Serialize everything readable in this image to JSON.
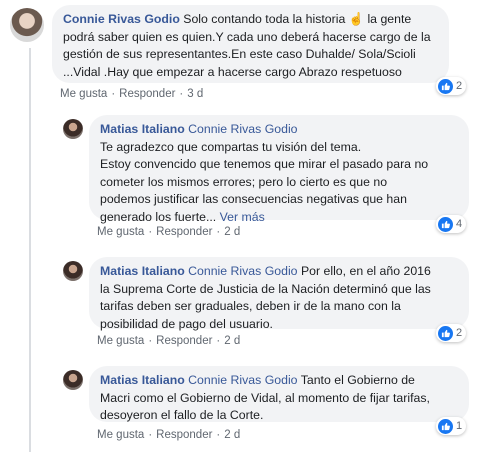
{
  "comments": [
    {
      "author": "Connie Rivas Godio",
      "text_line1": "Solo contando toda la historia",
      "emoji": "☝",
      "text_line1b": "la gente",
      "line2": "podrá saber quien es quien.Y cada uno deberá hacerse cargo de la",
      "line3": "gestión de sus representantes.En este caso Duhalde/ Sola/Scioli",
      "line4": "...Vidal .Hay que empezar a hacerse cargo Abrazo respetuoso",
      "like": "Me gusta",
      "reply": "Responder",
      "sep": "·",
      "time": "3 d",
      "reactions": "2"
    },
    {
      "author": "Matias Italiano",
      "mention": "Connie Rivas Godio",
      "line1": "Te agradezco que compartas tu visión del tema.",
      "line2": "Estoy convencido que tenemos que mirar el pasado para no",
      "line3": "cometer los mismos errores; pero lo cierto es que no",
      "line4": "podemos justificar las consecuencias negativas que han",
      "line5": "generado los fuerte...",
      "see_more": "Ver más",
      "like": "Me gusta",
      "reply": "Responder",
      "sep": "·",
      "time": "2 d",
      "reactions": "4"
    },
    {
      "author": "Matias Italiano",
      "mention": "Connie Rivas Godio",
      "line1": "Por ello, en el año 2016",
      "line2": "la Suprema Corte de Justicia de la Nación determinó que las",
      "line3": "tarifas deben ser graduales, deben ir de la mano con la",
      "line4": "posibilidad de pago del usuario.",
      "like": "Me gusta",
      "reply": "Responder",
      "sep": "·",
      "time": "2 d",
      "reactions": "2"
    },
    {
      "author": "Matias Italiano",
      "mention": "Connie Rivas Godio",
      "line1": "Tanto el Gobierno de",
      "line2": "Macri como el Gobierno de Vidal, al momento de fijar tarifas,",
      "line3": "desoyeron el fallo de la Corte.",
      "like": "Me gusta",
      "reply": "Responder",
      "sep": "·",
      "time": "2 d",
      "reactions": "1"
    }
  ],
  "colors": {
    "link": "#385898",
    "bubble": "#f2f3f5",
    "like_blue": "#1877f2",
    "meta": "#606770"
  },
  "icons": {
    "reaction": "thumbs-up-icon"
  }
}
